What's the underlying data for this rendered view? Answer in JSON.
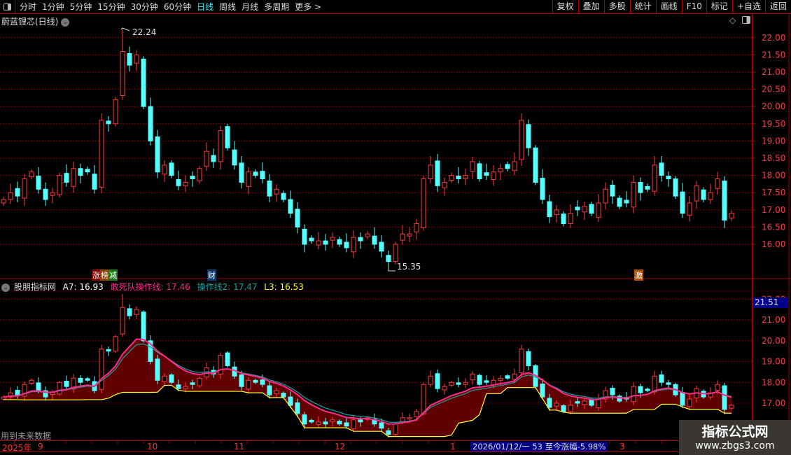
{
  "toolbar": {
    "periods": [
      "分时",
      "1分钟",
      "5分钟",
      "15分钟",
      "30分钟",
      "60分钟",
      "日线",
      "周线",
      "月线",
      "多周期",
      "更多 >"
    ],
    "active_period": "日线",
    "right_buttons": [
      "复权",
      "叠加",
      "多股",
      "统计",
      "画线",
      "F10",
      "标记",
      "+自选",
      "返回"
    ]
  },
  "chart_title": "蔚蓝锂芯(日线)",
  "markers": {
    "high_label": "22.24",
    "low_label": "15.35",
    "tags": [
      "涨",
      "榜",
      "减",
      "财",
      "激"
    ]
  },
  "indicator": {
    "name": "股朋指标网",
    "a7": "A7: 16.93",
    "line1": "敢死队操作线: 17.46",
    "line2": "操作线2: 17.47",
    "l3": "L3: 16.53",
    "future_note": "用到未来数据",
    "current_price_box": "21.51"
  },
  "date_axis": {
    "labels": [
      "2025年",
      "9",
      "10",
      "11",
      "12",
      "1",
      "3"
    ],
    "info": "2026/01/12/一 53 至今涨幅-5.98%"
  },
  "watermark": {
    "line1": "指标公式网",
    "line2": "www.zbgs3.com"
  },
  "colors": {
    "up": "#ff3b3b",
    "down": "#54ffff",
    "line1": "#ff2a8a",
    "line2": "#1aa0a0",
    "l3": "#ffff33",
    "fill": "#6a0000",
    "grid": "#a00000"
  },
  "chart_data": {
    "type": "candlestick",
    "main_axis_ticks": [
      "22.00",
      "21.50",
      "21.00",
      "20.50",
      "20.00",
      "19.50",
      "19.00",
      "18.50",
      "18.00",
      "17.50",
      "17.00",
      "16.50",
      "16.00"
    ],
    "lower_axis_ticks": [
      "21.00",
      "20.00",
      "19.00",
      "18.00",
      "17.00"
    ],
    "high": 22.24,
    "low": 15.35,
    "close": [
      17.3,
      17.5,
      17.4,
      17.9,
      18.1,
      17.6,
      17.3,
      17.5,
      18.0,
      17.8,
      18.2,
      18.0,
      18.1,
      17.6,
      19.6,
      19.5,
      20.2,
      21.6,
      21.2,
      21.5,
      20.0,
      19.0,
      18.1,
      18.3,
      18.0,
      17.7,
      17.8,
      17.9,
      18.2,
      18.7,
      18.4,
      19.3,
      18.8,
      18.3,
      17.8,
      18.1,
      18.0,
      17.9,
      17.4,
      17.6,
      17.3,
      16.9,
      16.5,
      16.0,
      16.1,
      16.1,
      16.0,
      16.2,
      16.0,
      15.9,
      16.2,
      16.1,
      16.3,
      16.0,
      15.8,
      15.5,
      16.0,
      16.3,
      16.3,
      16.6,
      17.9,
      18.3,
      17.7,
      17.8,
      18.0,
      17.9,
      18.0,
      18.4,
      17.9,
      18.0,
      18.1,
      18.2,
      18.2,
      18.4,
      19.6,
      18.8,
      17.8,
      17.3,
      16.8,
      17.0,
      16.6,
      16.9,
      17.0,
      17.1,
      16.9,
      17.2,
      17.6,
      17.4,
      17.1,
      17.2,
      17.8,
      17.5,
      17.6,
      18.3,
      18.0,
      17.9,
      17.4,
      16.9,
      17.2,
      17.7,
      17.3,
      17.5,
      17.9,
      16.7,
      16.9
    ]
  }
}
